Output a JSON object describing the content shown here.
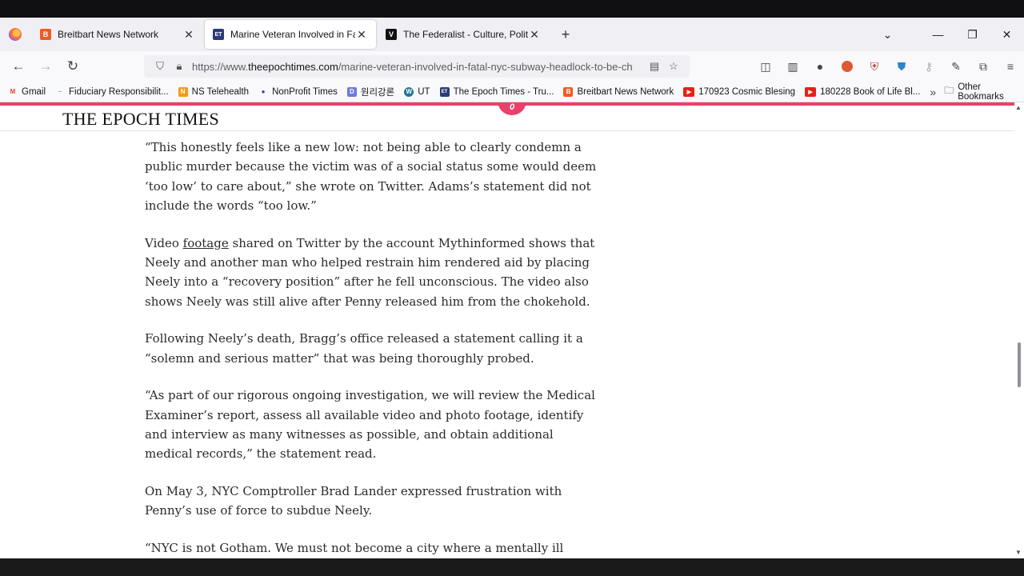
{
  "browser": {
    "tabs": [
      {
        "title": "Breitbart News Network",
        "favicon": "B",
        "favicon_color": "#f15a22",
        "active": false
      },
      {
        "title": "Marine Veteran Involved in Fatal",
        "favicon": "ET",
        "favicon_color": "#2b3a78",
        "active": true
      },
      {
        "title": "The Federalist - Culture, Politics",
        "favicon": "V",
        "favicon_color": "#111111",
        "active": false
      }
    ],
    "new_tab_icon": "+",
    "list_tabs_icon": "chevron-down-icon",
    "window_controls": {
      "minimize": "—",
      "restore": "❐",
      "close": "✕"
    },
    "url_prefix": "https://www.",
    "url_domain": "theepochtimes.com",
    "url_path": "/marine-veteran-involved-in-fatal-nyc-subway-headlock-to-be-ch",
    "bookmarks": [
      {
        "label": "Gmail",
        "icon": "M",
        "color": "#ea4335"
      },
      {
        "label": "Fiduciary Responsibilit...",
        "icon": "~",
        "color": "#7bb0d6"
      },
      {
        "label": "NS Telehealth",
        "icon": "N",
        "color": "#f39c12"
      },
      {
        "label": "NonProfit Times",
        "icon": "●",
        "color": "#3b3b8f"
      },
      {
        "label": "원리강론",
        "icon": "D",
        "color": "#6c7ae0"
      },
      {
        "label": "UT",
        "icon": "W",
        "color": "#21759b"
      },
      {
        "label": "The Epoch Times - Tru...",
        "icon": "ET",
        "color": "#2b3a78"
      },
      {
        "label": "Breitbart News Network",
        "icon": "B",
        "color": "#f15a22"
      },
      {
        "label": "170923 Cosmic Blesing",
        "icon": "▶",
        "color": "#e62117"
      },
      {
        "label": "180228 Book of Life Bl...",
        "icon": "▶",
        "color": "#e62117"
      }
    ],
    "bookmarks_more": "»",
    "other_bookmarks": "Other Bookmarks"
  },
  "site": {
    "logo": "THE EPOCH TIMES",
    "badge": "0"
  },
  "article": {
    "p1": "“This honestly feels like a new low: not being able to clearly condemn a public murder because the victim was of a social status some would deem ‘too low’ to care about,” she wrote on Twitter. Adams’s statement did not include the words “too low.”",
    "p2_before": "Video ",
    "p2_link": "footage",
    "p2_after": " shared on Twitter by the account Mythinformed shows that Neely and another man who helped restrain him rendered aid by placing Neely into a “recovery position” after he fell unconscious. The video also shows Neely was still alive after Penny released him from the chokehold.",
    "p3": "Following Neely’s death, Bragg’s office released a statement calling it a “solemn and serious matter” that was being thoroughly probed.",
    "p4": "“As part of our rigorous ongoing investigation, we will review the Medical Examiner’s report, assess all available video and photo footage, identify and interview as many witnesses as possible, and obtain additional medical records,” the statement read.",
    "p5": "On May 3, NYC Comptroller Brad Lander expressed frustration with Penny’s use of force to subdue Neely.",
    "p6": "“NYC is not Gotham. We must not become a city where a mentally ill"
  }
}
